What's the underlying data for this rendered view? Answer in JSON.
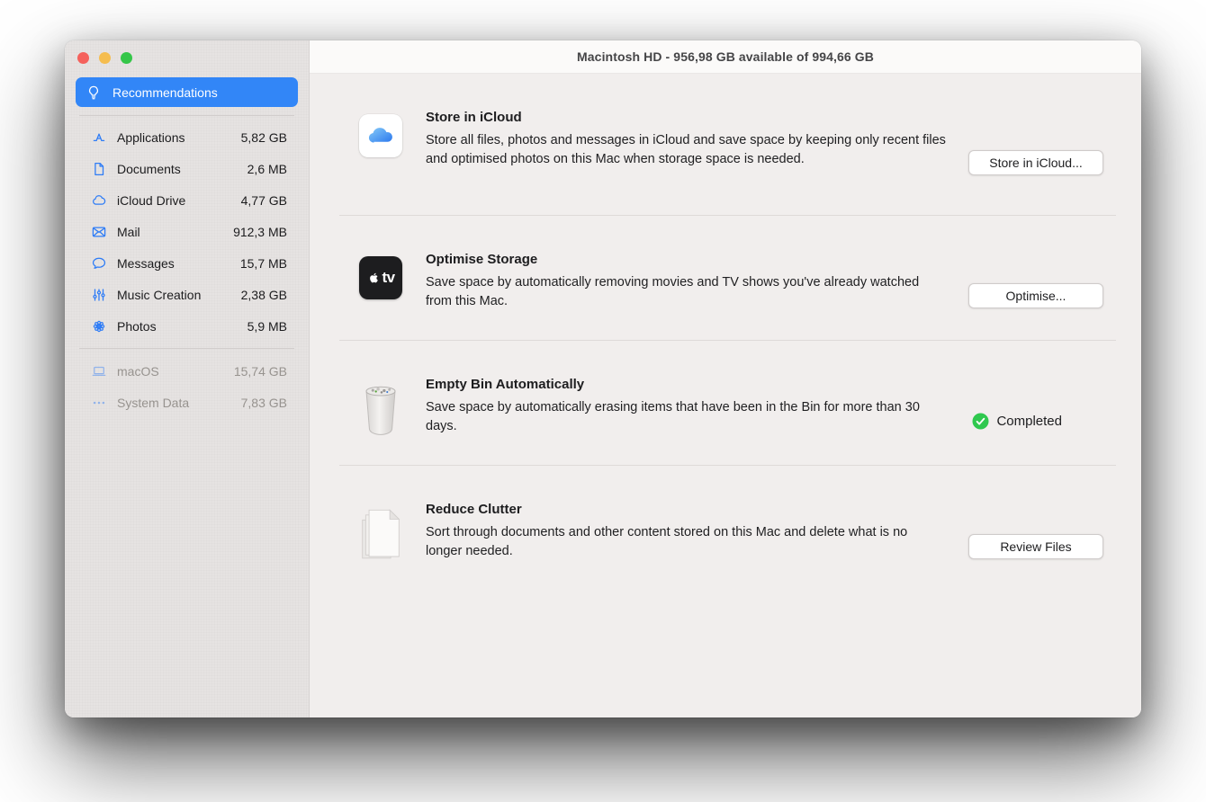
{
  "window": {
    "title": "Macintosh HD - 956,98 GB available of 994,66 GB"
  },
  "sidebar": {
    "selected": {
      "label": "Recommendations",
      "icon": "lightbulb-icon"
    },
    "items": [
      {
        "label": "Applications",
        "size": "5,82 GB",
        "icon": "appstore-icon"
      },
      {
        "label": "Documents",
        "size": "2,6 MB",
        "icon": "document-icon"
      },
      {
        "label": "iCloud Drive",
        "size": "4,77 GB",
        "icon": "cloud-icon"
      },
      {
        "label": "Mail",
        "size": "912,3 MB",
        "icon": "mail-icon"
      },
      {
        "label": "Messages",
        "size": "15,7 MB",
        "icon": "message-bubble-icon"
      },
      {
        "label": "Music Creation",
        "size": "2,38 GB",
        "icon": "faders-icon"
      },
      {
        "label": "Photos",
        "size": "5,9 MB",
        "icon": "photos-pinwheel-icon"
      }
    ],
    "system_items": [
      {
        "label": "macOS",
        "size": "15,74 GB",
        "icon": "laptop-icon"
      },
      {
        "label": "System Data",
        "size": "7,83 GB",
        "icon": "ellipsis-icon"
      }
    ]
  },
  "sections": [
    {
      "title": "Store in iCloud",
      "description": "Store all files, photos and messages in iCloud and save space by keeping only recent files and optimised photos on this Mac when storage space is needed.",
      "icon": "icloud-app-icon",
      "action": {
        "type": "button",
        "label": "Store in iCloud..."
      }
    },
    {
      "title": "Optimise Storage",
      "description": "Save space by automatically removing movies and TV shows you've already watched from this Mac.",
      "icon": "appletv-app-icon",
      "action": {
        "type": "button",
        "label": "Optimise..."
      }
    },
    {
      "title": "Empty Bin Automatically",
      "description": "Save space by automatically erasing items that have been in the Bin for more than 30 days.",
      "icon": "trash-full-icon",
      "action": {
        "type": "status",
        "label": "Completed"
      }
    },
    {
      "title": "Reduce Clutter",
      "description": "Sort through documents and other content stored on this Mac and delete what is no longer needed.",
      "icon": "documents-stack-icon",
      "action": {
        "type": "button",
        "label": "Review Files"
      }
    }
  ],
  "colors": {
    "accent_blue": "#2e7cf6",
    "selected_blue": "#3286f7",
    "success_green": "#2fc84e",
    "traffic_red": "#f5615c",
    "traffic_yellow": "#f5bd4f",
    "traffic_green": "#35c649"
  }
}
